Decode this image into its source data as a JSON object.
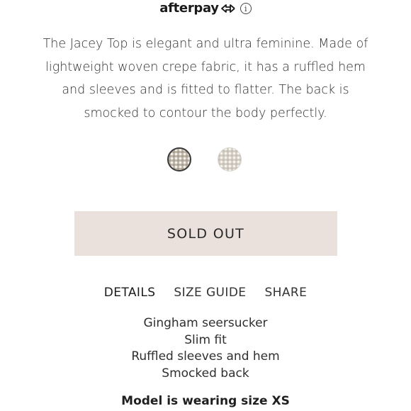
{
  "afterpay": {
    "logo_text": "afterpay",
    "icons": [
      "afterpay-arrows-icon",
      "info-icon"
    ],
    "info_glyph": "i"
  },
  "product": {
    "description": "The Jacey Top is elegant and ultra feminine. Made of lightweight woven crepe fabric, it has a ruffled hem and sleeves and is fitted to flatter. The back is smocked to contour the body perfectly."
  },
  "swatches": [
    {
      "pattern": "gingham",
      "color": "#968c7d",
      "selected": true
    },
    {
      "pattern": "gingham",
      "color": "#b9b2a8",
      "selected": false
    }
  ],
  "cta": {
    "label": "SOLD OUT",
    "background": "#ebe1dc"
  },
  "tabs": [
    {
      "label": "DETAILS",
      "active": true
    },
    {
      "label": "SIZE GUIDE",
      "active": false
    },
    {
      "label": "SHARE",
      "active": false
    }
  ],
  "details": {
    "items": [
      "Gingham seersucker",
      "Slim fit",
      "Ruffled sleeves and hem",
      "Smocked back"
    ],
    "model_note": "Model is wearing size XS"
  }
}
